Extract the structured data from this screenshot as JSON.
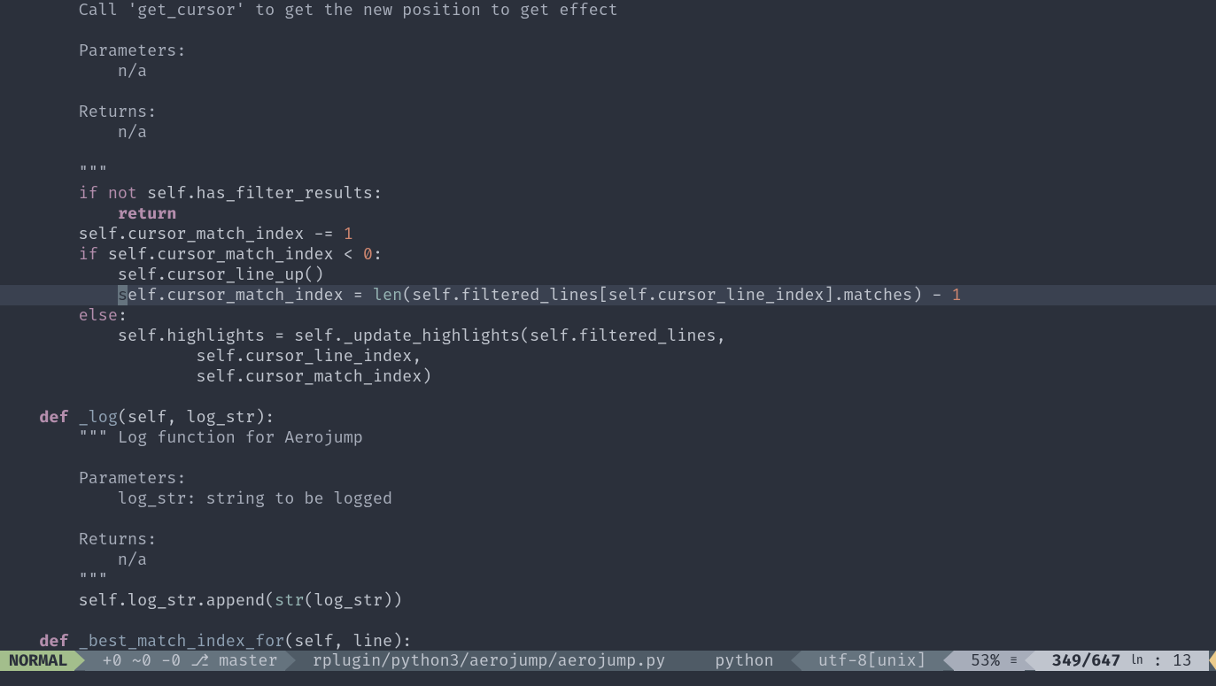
{
  "code": {
    "l1": "        Call 'get_cursor' to get the new position to get effect",
    "l2": "",
    "l3": "        Parameters:",
    "l4": "            n/a",
    "l5": "",
    "l6": "        Returns:",
    "l7": "            n/a",
    "l8": "",
    "l9": "        \"\"\"",
    "l10_if": "if",
    "l10_not": "not",
    "l10_rest": " self.has_filter_results:",
    "l11": "return",
    "l12_a": "        self.cursor_match_index -= ",
    "l12_num": "1",
    "l13_if": "if",
    "l13_mid": " self.cursor_match_index < ",
    "l13_num": "0",
    "l13_colon": ":",
    "l14": "            self.cursor_line_up()",
    "l15_cur": "s",
    "l15_a": "elf.cursor_match_index = ",
    "l15_len": "len",
    "l15_b": "(self.filtered_lines[self.cursor_line_index].matches) - ",
    "l15_num": "1",
    "l16_else": "else",
    "l16_colon": ":",
    "l17": "            self.highlights = self._update_highlights(self.filtered_lines,",
    "l18": "                    self.cursor_line_index,",
    "l19": "                    self.cursor_match_index)",
    "l20": "",
    "l21_def": "def",
    "l21_name": "_log",
    "l21_args": "(self, log_str):",
    "l22": "        \"\"\" Log function for Aerojump",
    "l23": "",
    "l24": "        Parameters:",
    "l25": "            log_str: string to be logged",
    "l26": "",
    "l27": "        Returns:",
    "l28": "            n/a",
    "l29": "        \"\"\"",
    "l30_a": "        self.log_str.append(",
    "l30_str": "str",
    "l30_b": "(log_str))",
    "l31": "",
    "l32_def": "def",
    "l32_name": "_best_match_index_for",
    "l32_args": "(self, line):"
  },
  "status": {
    "mode": "NORMAL",
    "git_stats": " +0 ~0 -0 ",
    "branch_icon": "⎇",
    "branch": " master",
    "filepath": " rplugin/python3/aerojump/aerojump.py",
    "filetype": "python ",
    "encoding": " utf-8[unix] ",
    "percent": " 53% ",
    "percent_glyph": "☰",
    "line_total": " 349/647 ",
    "ln_glyph": "㏑",
    "col": " : 13 "
  }
}
